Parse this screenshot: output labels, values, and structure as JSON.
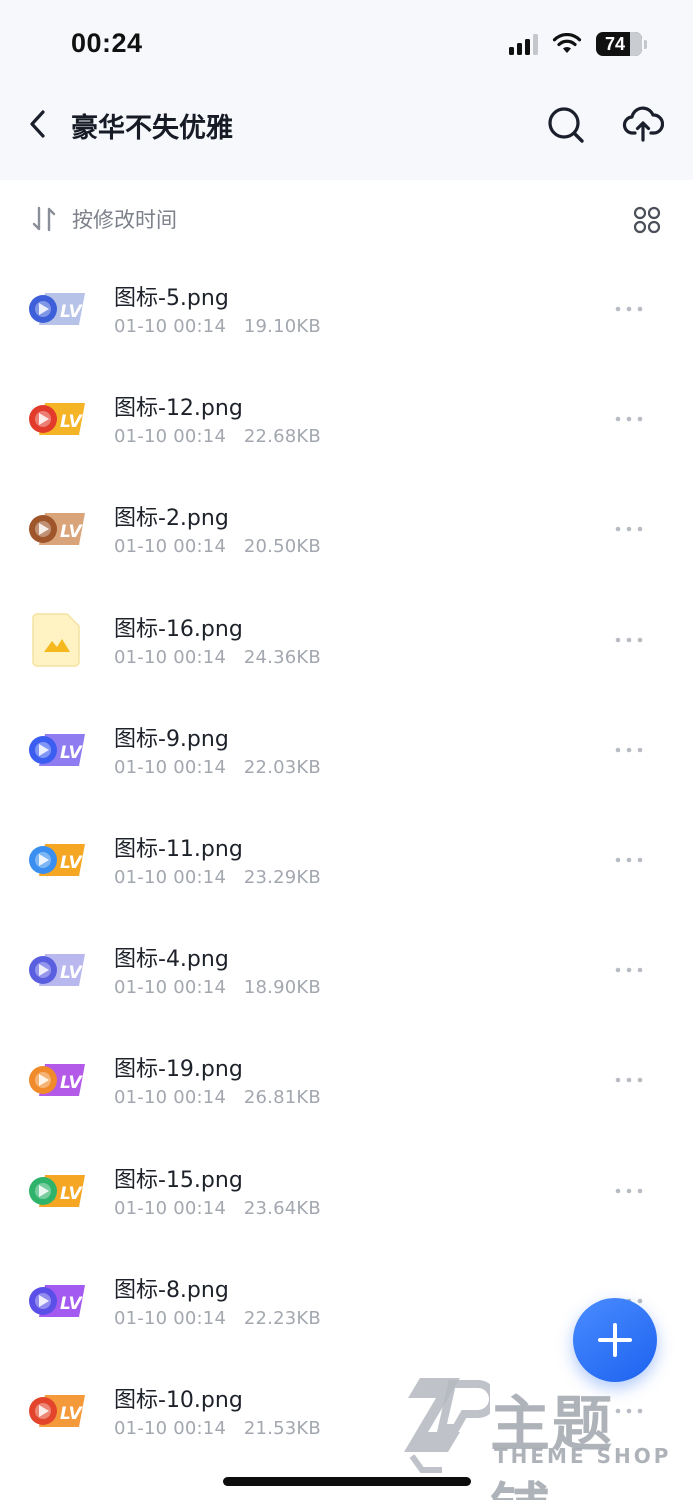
{
  "status_bar": {
    "time": "00:24",
    "battery": "74",
    "battery_level": 0.74
  },
  "nav": {
    "title": "豪华不失优雅"
  },
  "toolbar": {
    "sort_label": "按修改时间"
  },
  "files": [
    {
      "name": "图标-5.png",
      "date": "01-10 00:14",
      "size": "19.10KB",
      "icon": "silver-lv-badge-thumbnail",
      "colors": [
        "#3d5fd9",
        "#b7c2e8"
      ]
    },
    {
      "name": "图标-12.png",
      "date": "01-10 00:14",
      "size": "22.68KB",
      "icon": "orange-lv-badge-thumbnail",
      "colors": [
        "#e23b2b",
        "#f5b326"
      ]
    },
    {
      "name": "图标-2.png",
      "date": "01-10 00:14",
      "size": "20.50KB",
      "icon": "bronze-lv-badge-thumbnail",
      "colors": [
        "#a0562b",
        "#d9a47a"
      ]
    },
    {
      "name": "图标-16.png",
      "date": "01-10 00:14",
      "size": "24.36KB",
      "icon": "image-file-icon",
      "colors": [
        "#fff3c4",
        "#f5b81f"
      ]
    },
    {
      "name": "图标-9.png",
      "date": "01-10 00:14",
      "size": "22.03KB",
      "icon": "blue-purple-lv-badge-thumbnail",
      "colors": [
        "#3b5ef0",
        "#8f7cf0"
      ]
    },
    {
      "name": "图标-11.png",
      "date": "01-10 00:14",
      "size": "23.29KB",
      "icon": "gold-lv-badge-thumbnail",
      "colors": [
        "#3a8ef0",
        "#f5a623"
      ]
    },
    {
      "name": "图标-4.png",
      "date": "01-10 00:14",
      "size": "18.90KB",
      "icon": "lavender-lv-badge-thumbnail",
      "colors": [
        "#5a5fe0",
        "#b9b8ee"
      ]
    },
    {
      "name": "图标-19.png",
      "date": "01-10 00:14",
      "size": "26.81KB",
      "icon": "purple-lv-badge-thumbnail",
      "colors": [
        "#f08a2a",
        "#b35be8"
      ]
    },
    {
      "name": "图标-15.png",
      "date": "01-10 00:14",
      "size": "23.64KB",
      "icon": "amber-lv-badge-thumbnail",
      "colors": [
        "#2fb36b",
        "#f5a623"
      ]
    },
    {
      "name": "图标-8.png",
      "date": "01-10 00:14",
      "size": "22.23KB",
      "icon": "violet-lv-badge-thumbnail",
      "colors": [
        "#5a4fe6",
        "#a35af0"
      ]
    },
    {
      "name": "图标-10.png",
      "date": "01-10 00:14",
      "size": "21.53KB",
      "icon": "red-orange-lv-badge-thumbnail",
      "colors": [
        "#e2452b",
        "#f59a3a"
      ]
    }
  ],
  "watermark": {
    "title": "主题铺",
    "subtitle": "THEME SHOP"
  },
  "theme": {
    "accent": "#2a6ef5",
    "header_bg": "#f6f8fc",
    "text_secondary": "#a3a7af"
  }
}
